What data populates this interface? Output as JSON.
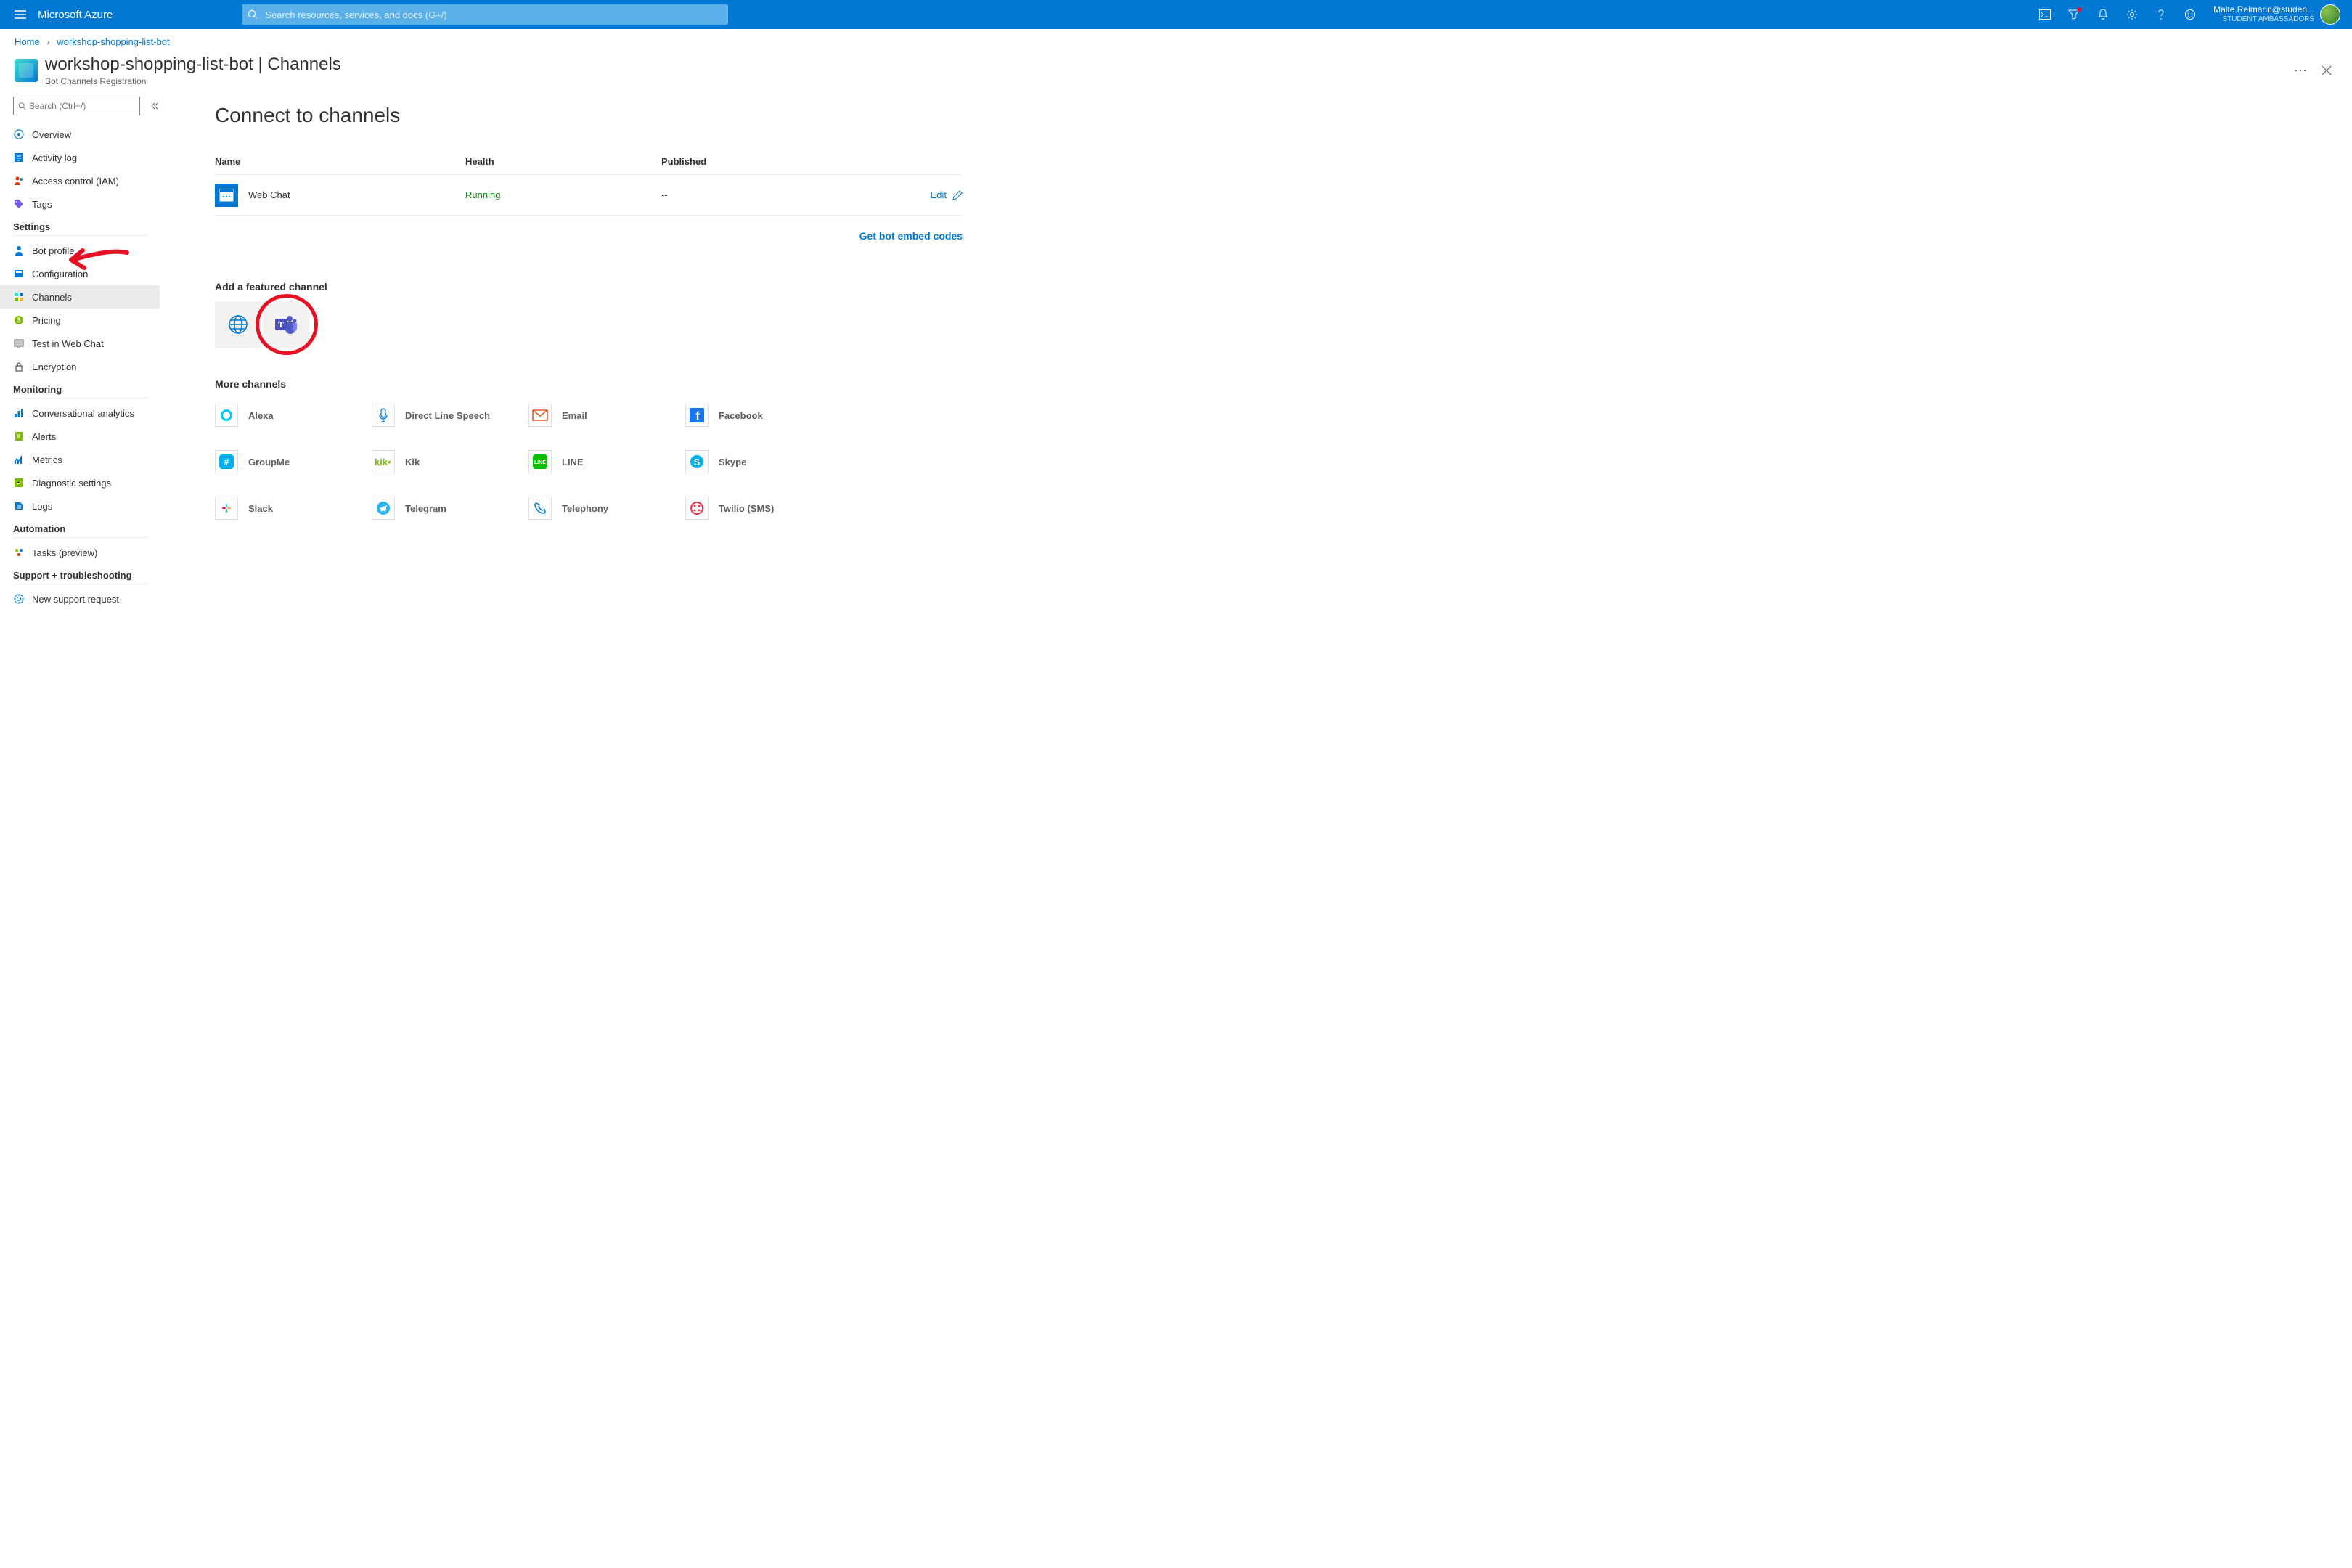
{
  "topbar": {
    "brand": "Microsoft Azure",
    "search_placeholder": "Search resources, services, and docs (G+/)",
    "user_name": "Malte.Reimann@studen...",
    "user_org": "STUDENT AMBASSADORS"
  },
  "breadcrumb": {
    "home": "Home",
    "current": "workshop-shopping-list-bot"
  },
  "page": {
    "title_resource": "workshop-shopping-list-bot",
    "title_section": "Channels",
    "subtitle": "Bot Channels Registration"
  },
  "sidebar": {
    "search_placeholder": "Search (Ctrl+/)",
    "top_items": [
      "Overview",
      "Activity log",
      "Access control (IAM)",
      "Tags"
    ],
    "groups": [
      {
        "header": "Settings",
        "items": [
          "Bot profile",
          "Configuration",
          "Channels",
          "Pricing",
          "Test in Web Chat",
          "Encryption"
        ]
      },
      {
        "header": "Monitoring",
        "items": [
          "Conversational analytics",
          "Alerts",
          "Metrics",
          "Diagnostic settings",
          "Logs"
        ]
      },
      {
        "header": "Automation",
        "items": [
          "Tasks (preview)"
        ]
      },
      {
        "header": "Support + troubleshooting",
        "items": [
          "New support request"
        ]
      }
    ],
    "active": "Channels"
  },
  "content": {
    "heading": "Connect to channels",
    "columns": {
      "name": "Name",
      "health": "Health",
      "published": "Published"
    },
    "row": {
      "name": "Web Chat",
      "health": "Running",
      "published": "--",
      "edit": "Edit"
    },
    "embed_link": "Get bot embed codes",
    "featured_header": "Add a featured channel",
    "featured": [
      "Direct Line",
      "Microsoft Teams"
    ],
    "more_header": "More channels",
    "more": [
      "Alexa",
      "Direct Line Speech",
      "Email",
      "Facebook",
      "GroupMe",
      "Kik",
      "LINE",
      "Skype",
      "Slack",
      "Telegram",
      "Telephony",
      "Twilio (SMS)"
    ]
  }
}
